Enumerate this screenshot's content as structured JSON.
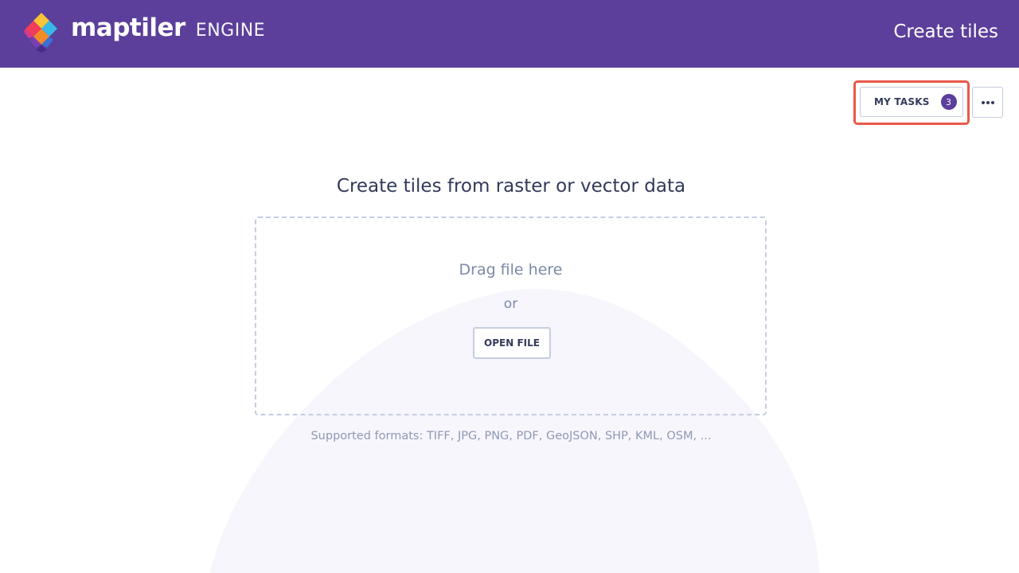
{
  "header": {
    "brand_name": "maptiler",
    "brand_product": "ENGINE",
    "page_title": "Create tiles",
    "logo_icon": "maptiler-logo-icon"
  },
  "toolbar": {
    "tasks_label": "MY TASKS",
    "tasks_count": "3",
    "more_icon": "more-horizontal-icon"
  },
  "main": {
    "heading": "Create tiles from raster or vector data",
    "drag_text": "Drag file here",
    "or_text": "or",
    "open_file_label": "OPEN FILE",
    "supported_formats": "Supported formats: TIFF, JPG, PNG, PDF, GeoJSON, SHP, KML, OSM, ..."
  },
  "colors": {
    "header_bg": "#5b3f9a",
    "accent": "#5b3f9a",
    "highlight": "#e8594a",
    "text_dark": "#33395a",
    "text_muted": "#7b89a8"
  }
}
